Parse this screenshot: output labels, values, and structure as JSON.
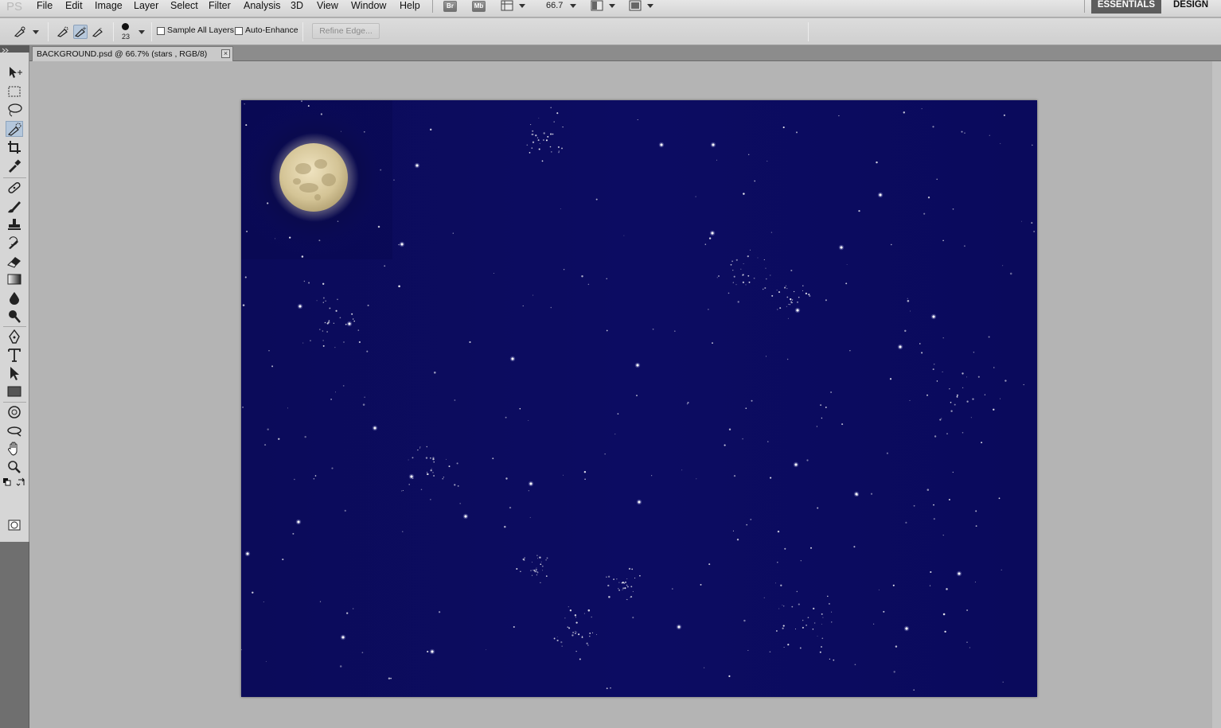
{
  "app": {
    "logo": "PS"
  },
  "menu": {
    "items": [
      "File",
      "Edit",
      "Image",
      "Layer",
      "Select",
      "Filter",
      "Analysis",
      "3D",
      "View",
      "Window",
      "Help"
    ],
    "bridge_label": "Br",
    "minibridge_label": "Mb",
    "zoom": "66.7"
  },
  "workspaces": {
    "essentials": "ESSENTIALS",
    "design": "DESIGN"
  },
  "options": {
    "brush_size": "23",
    "sample_all_layers": "Sample All Layers",
    "auto_enhance": "Auto-Enhance",
    "refine_edge": "Refine Edge..."
  },
  "document": {
    "tab_title": "BACKGROUND.psd @ 66.7% (stars , RGB/8)",
    "close_glyph": "×"
  },
  "colors": {
    "foreground": "#0a0a57",
    "background": "#0a0a66",
    "sky": "#0b0b5e",
    "moon": "#d8c9a0"
  },
  "tools": [
    "move-tool-icon",
    "marquee-tool-icon",
    "lasso-tool-icon",
    "quick-selection-tool-icon",
    "crop-tool-icon",
    "eyedropper-tool-icon",
    "healing-brush-tool-icon",
    "brush-tool-icon",
    "clone-stamp-tool-icon",
    "history-brush-tool-icon",
    "eraser-tool-icon",
    "gradient-tool-icon",
    "blur-tool-icon",
    "dodge-tool-icon",
    "pen-tool-icon",
    "type-tool-icon",
    "path-selection-tool-icon",
    "rectangle-tool-icon",
    "3d-rotate-tool-icon",
    "3d-orbit-tool-icon",
    "hand-tool-icon",
    "zoom-tool-icon",
    "quick-mask-icon"
  ]
}
